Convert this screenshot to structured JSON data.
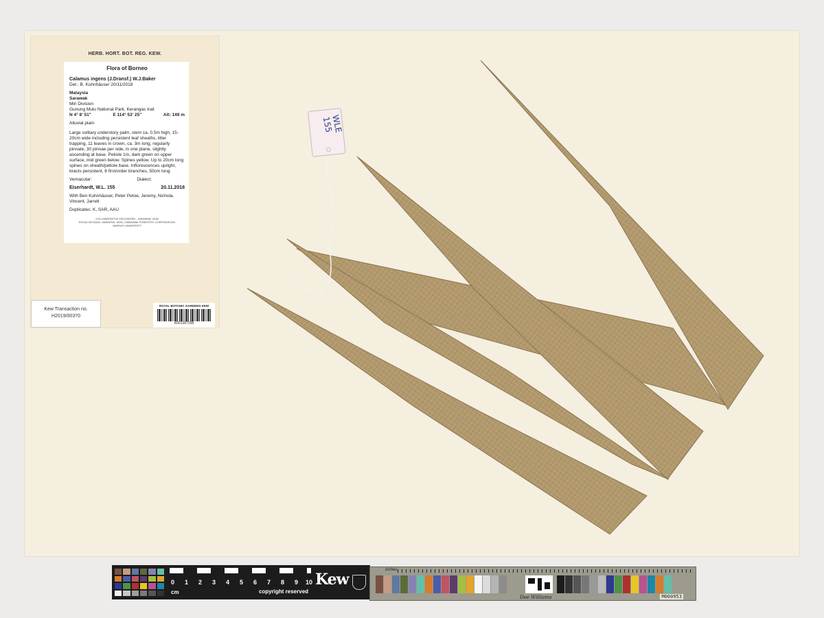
{
  "label": {
    "herbarium": "HERB. HORT. BOT. REG. KEW.",
    "flora": "Flora of Borneo",
    "species": "Calamus  ingens  (J.Dransf.) W.J.Baker",
    "determination": "Det.:  B. Kuhnhäuser 20/11/2018",
    "country": "Malaysia",
    "state": "Sarawak",
    "division": "Miri Division",
    "locality": "Gunung Mulu National Park, Kerangas trail",
    "latitude": "N 4° 8' 51\"",
    "longitude": "E 114° 53' 25\"",
    "altitude": "Alt:  149 m",
    "habitat": "Alluvial plain",
    "description": "Large solitary understory palm, stem ca. 0.5m high, 15-20cm wide including persistent leaf sheaths, litter trapping, 11 leaves in crown, ca. 3m long, regularly pinnate, 30 pinnae per side, in one plane, slightly ascending at base. Petiole 1m, dark green on upper surface, mid green below. Spines yellow. Up to 20cm long spines on sheath/petiole base. Inflorescences upright, bracts persistent, 8 first/order branches, 50cm long.",
    "vernacular": "Vernacular:",
    "dialect": "Dialect:",
    "collector": "Eiserhardt, W.L.   155",
    "date": "20.11.2018",
    "with": "With Ben Kuhnhäuser, Peter Petoe, Jeremy, Nichola, Vincent, Jarrett",
    "duplicates": "Duplicates: K, SAR, AAU",
    "footer_1": "COLLABORATIVE FIELDWORK - SARAWAK 2018",
    "footer_2": "ROYAL BOTANIC GARDENS, KEW | SARAWAK FORESTRY CORPORATION",
    "footer_3": "AARHUS UNIVERSITY"
  },
  "transaction": {
    "line1": "Kew Transaction no.",
    "line2": "H2019/00370"
  },
  "barcode": {
    "header": "ROYAL BOTANIC GARDENS KEW",
    "number": "K001287298"
  },
  "tag": {
    "text1": "WLE",
    "text2": "155"
  },
  "scale_bar": {
    "numbers": [
      "0",
      "1",
      "2",
      "3",
      "4",
      "5",
      "6",
      "7",
      "8",
      "9",
      "10"
    ],
    "unit": "cm",
    "copyright": "copyright reserved",
    "logo": "Kew"
  },
  "color_card": {
    "inches": "inches",
    "signature": "Dee Williams",
    "code": "M000953"
  },
  "colors": {
    "sheet": "#f5efe0",
    "leaf": "#b39a6e",
    "leaf_dark": "#8a7450",
    "scale_bg": "#1c1c1c"
  }
}
